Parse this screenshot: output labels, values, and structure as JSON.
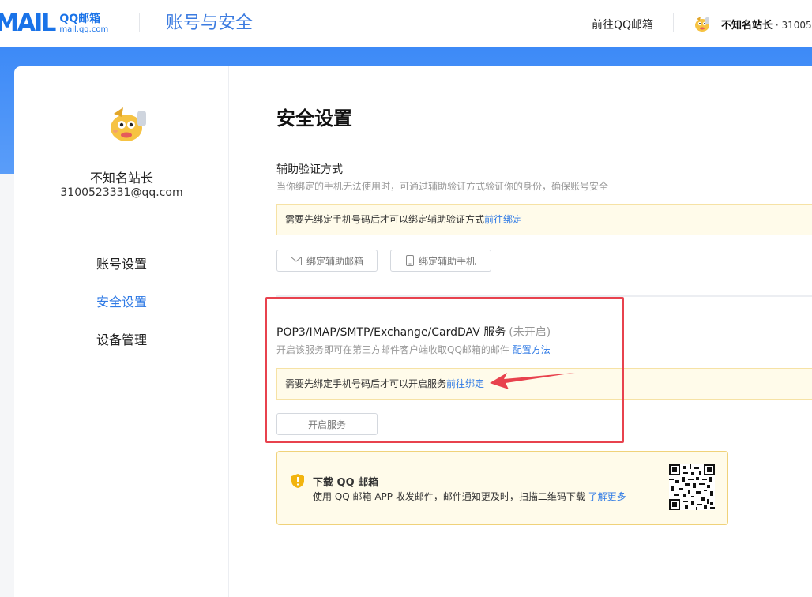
{
  "header": {
    "logo_mail": "MAIL",
    "logo_qq": "QQ邮箱",
    "logo_domain": "mail.qq.com",
    "title": "账号与安全",
    "goto_label": "前往QQ邮箱",
    "user_name": "不知名站长",
    "user_account": " · 31005"
  },
  "sidebar": {
    "name": "不知名站长",
    "email": "3100523331@qq.com",
    "items": [
      {
        "label": "账号设置",
        "active": false
      },
      {
        "label": "安全设置",
        "active": true
      },
      {
        "label": "设备管理",
        "active": false
      }
    ]
  },
  "main": {
    "title": "安全设置",
    "aux": {
      "title": "辅助验证方式",
      "desc": "当你绑定的手机无法使用时，可通过辅助验证方式验证你的身份，确保账号安全",
      "notice": "需要先绑定手机号码后才可以绑定辅助验证方式",
      "notice_link": "前往绑定",
      "btn_email": "绑定辅助邮箱",
      "btn_phone": "绑定辅助手机"
    },
    "pop3": {
      "title": "POP3/IMAP/SMTP/Exchange/CardDAV 服务",
      "status": "(未开启)",
      "desc": "开启该服务即可在第三方邮件客户端收取QQ邮箱的邮件",
      "desc_link": "配置方法",
      "notice": "需要先绑定手机号码后才可以开启服务",
      "notice_link": "前往绑定",
      "btn_open": "开启服务"
    },
    "download": {
      "title": "下载 QQ 邮箱",
      "desc": "使用 QQ 邮箱 APP 收发邮件，邮件通知更及时，扫描二维码下载",
      "link": "了解更多"
    }
  },
  "colors": {
    "accent": "#2f7ae5",
    "banner": "#3d8af7",
    "highlight": "#e8424e",
    "notice_bg": "#fffbea"
  }
}
